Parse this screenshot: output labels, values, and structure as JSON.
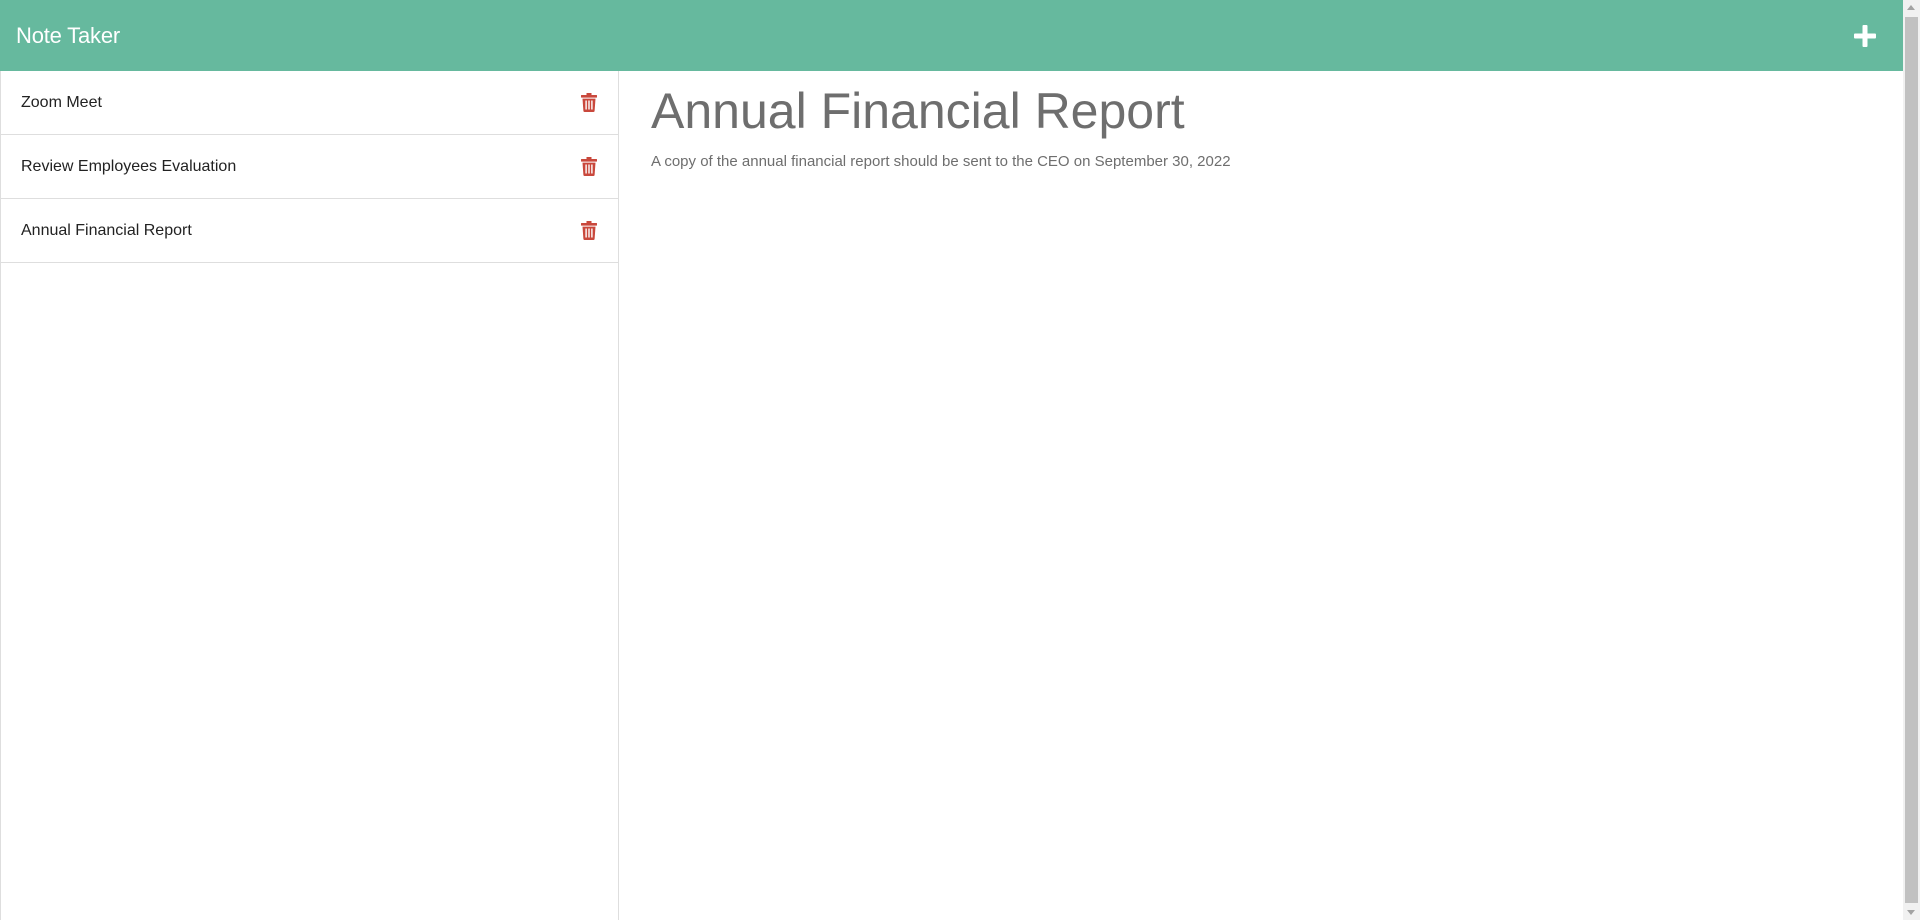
{
  "header": {
    "brand": "Note Taker",
    "add_icon": "plus-icon"
  },
  "sidebar": {
    "notes": [
      {
        "title": "Zoom Meet",
        "delete_icon": "trash-icon"
      },
      {
        "title": "Review Employees Evaluation",
        "delete_icon": "trash-icon"
      },
      {
        "title": "Annual Financial Report",
        "delete_icon": "trash-icon"
      }
    ]
  },
  "main": {
    "title": "Annual Financial Report",
    "text": "A copy of the annual financial report should be sent to the CEO on September 30, 2022"
  },
  "colors": {
    "header_bg": "#66b99e",
    "delete_icon": "#c9483c",
    "note_text": "#6e6e6e"
  }
}
